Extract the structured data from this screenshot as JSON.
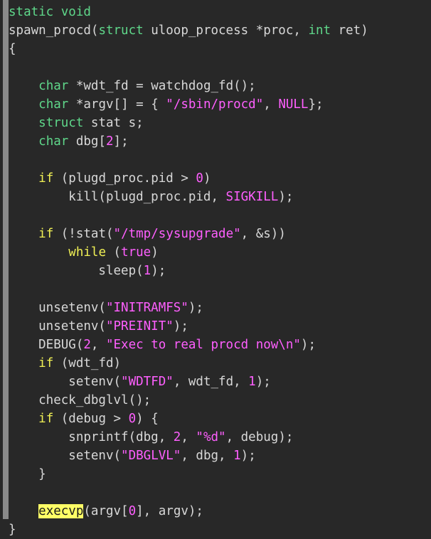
{
  "editor": {
    "background": "#282828",
    "default_text_color": "#d8d8d8",
    "scrollbar_color": "#8a8a8a",
    "language": "c",
    "colors": {
      "type_keyword": "#5fd78a",
      "control_keyword": "#f0f055",
      "literal": "#ff5fff",
      "identifier": "#d8d8d8",
      "search_match_bg": "#ffff66",
      "search_match_fg": "#1a1a1a"
    },
    "search_match_text": "execvp"
  },
  "code_lines": [
    [
      {
        "t": "static",
        "c": "type"
      },
      {
        "t": " ",
        "c": "plain"
      },
      {
        "t": "void",
        "c": "type"
      }
    ],
    [
      {
        "t": "spawn_procd(",
        "c": "plain"
      },
      {
        "t": "struct",
        "c": "type"
      },
      {
        "t": " uloop_process *proc, ",
        "c": "plain"
      },
      {
        "t": "int",
        "c": "type"
      },
      {
        "t": " ret)",
        "c": "plain"
      }
    ],
    [
      {
        "t": "{",
        "c": "plain"
      }
    ],
    [
      {
        "t": "",
        "c": "plain"
      }
    ],
    [
      {
        "t": "    ",
        "c": "plain"
      },
      {
        "t": "char",
        "c": "type"
      },
      {
        "t": " *wdt_fd = watchdog_fd();",
        "c": "plain"
      }
    ],
    [
      {
        "t": "    ",
        "c": "plain"
      },
      {
        "t": "char",
        "c": "type"
      },
      {
        "t": " *argv[] = { ",
        "c": "plain"
      },
      {
        "t": "\"/sbin/procd\"",
        "c": "lit"
      },
      {
        "t": ", ",
        "c": "plain"
      },
      {
        "t": "NULL",
        "c": "lit"
      },
      {
        "t": "};",
        "c": "plain"
      }
    ],
    [
      {
        "t": "    ",
        "c": "plain"
      },
      {
        "t": "struct",
        "c": "type"
      },
      {
        "t": " stat s;",
        "c": "plain"
      }
    ],
    [
      {
        "t": "    ",
        "c": "plain"
      },
      {
        "t": "char",
        "c": "type"
      },
      {
        "t": " dbg[",
        "c": "plain"
      },
      {
        "t": "2",
        "c": "lit"
      },
      {
        "t": "];",
        "c": "plain"
      }
    ],
    [
      {
        "t": "",
        "c": "plain"
      }
    ],
    [
      {
        "t": "    ",
        "c": "plain"
      },
      {
        "t": "if",
        "c": "ctrl"
      },
      {
        "t": " (plugd_proc.pid > ",
        "c": "plain"
      },
      {
        "t": "0",
        "c": "lit"
      },
      {
        "t": ")",
        "c": "plain"
      }
    ],
    [
      {
        "t": "        kill(plugd_proc.pid, ",
        "c": "plain"
      },
      {
        "t": "SIGKILL",
        "c": "lit"
      },
      {
        "t": ");",
        "c": "plain"
      }
    ],
    [
      {
        "t": "",
        "c": "plain"
      }
    ],
    [
      {
        "t": "    ",
        "c": "plain"
      },
      {
        "t": "if",
        "c": "ctrl"
      },
      {
        "t": " (!stat(",
        "c": "plain"
      },
      {
        "t": "\"/tmp/sysupgrade\"",
        "c": "lit"
      },
      {
        "t": ", &s))",
        "c": "plain"
      }
    ],
    [
      {
        "t": "        ",
        "c": "plain"
      },
      {
        "t": "while",
        "c": "ctrl"
      },
      {
        "t": " (",
        "c": "plain"
      },
      {
        "t": "true",
        "c": "lit"
      },
      {
        "t": ")",
        "c": "plain"
      }
    ],
    [
      {
        "t": "            sleep(",
        "c": "plain"
      },
      {
        "t": "1",
        "c": "lit"
      },
      {
        "t": ");",
        "c": "plain"
      }
    ],
    [
      {
        "t": "",
        "c": "plain"
      }
    ],
    [
      {
        "t": "    unsetenv(",
        "c": "plain"
      },
      {
        "t": "\"INITRAMFS\"",
        "c": "lit"
      },
      {
        "t": ");",
        "c": "plain"
      }
    ],
    [
      {
        "t": "    unsetenv(",
        "c": "plain"
      },
      {
        "t": "\"PREINIT\"",
        "c": "lit"
      },
      {
        "t": ");",
        "c": "plain"
      }
    ],
    [
      {
        "t": "    DEBUG(",
        "c": "plain"
      },
      {
        "t": "2",
        "c": "lit"
      },
      {
        "t": ", ",
        "c": "plain"
      },
      {
        "t": "\"Exec to real procd now\\n\"",
        "c": "lit"
      },
      {
        "t": ");",
        "c": "plain"
      }
    ],
    [
      {
        "t": "    ",
        "c": "plain"
      },
      {
        "t": "if",
        "c": "ctrl"
      },
      {
        "t": " (wdt_fd)",
        "c": "plain"
      }
    ],
    [
      {
        "t": "        setenv(",
        "c": "plain"
      },
      {
        "t": "\"WDTFD\"",
        "c": "lit"
      },
      {
        "t": ", wdt_fd, ",
        "c": "plain"
      },
      {
        "t": "1",
        "c": "lit"
      },
      {
        "t": ");",
        "c": "plain"
      }
    ],
    [
      {
        "t": "    check_dbglvl();",
        "c": "plain"
      }
    ],
    [
      {
        "t": "    ",
        "c": "plain"
      },
      {
        "t": "if",
        "c": "ctrl"
      },
      {
        "t": " (debug > ",
        "c": "plain"
      },
      {
        "t": "0",
        "c": "lit"
      },
      {
        "t": ") {",
        "c": "plain"
      }
    ],
    [
      {
        "t": "        snprintf(dbg, ",
        "c": "plain"
      },
      {
        "t": "2",
        "c": "lit"
      },
      {
        "t": ", ",
        "c": "plain"
      },
      {
        "t": "\"%d\"",
        "c": "lit"
      },
      {
        "t": ", debug);",
        "c": "plain"
      }
    ],
    [
      {
        "t": "        setenv(",
        "c": "plain"
      },
      {
        "t": "\"DBGLVL\"",
        "c": "lit"
      },
      {
        "t": ", dbg, ",
        "c": "plain"
      },
      {
        "t": "1",
        "c": "lit"
      },
      {
        "t": ");",
        "c": "plain"
      }
    ],
    [
      {
        "t": "    }",
        "c": "plain"
      }
    ],
    [
      {
        "t": "",
        "c": "plain"
      }
    ],
    [
      {
        "t": "    ",
        "c": "plain"
      },
      {
        "t": "execvp",
        "c": "match"
      },
      {
        "t": "(argv[",
        "c": "plain"
      },
      {
        "t": "0",
        "c": "lit"
      },
      {
        "t": "], argv);",
        "c": "plain"
      }
    ],
    [
      {
        "t": "}",
        "c": "plain"
      }
    ]
  ]
}
